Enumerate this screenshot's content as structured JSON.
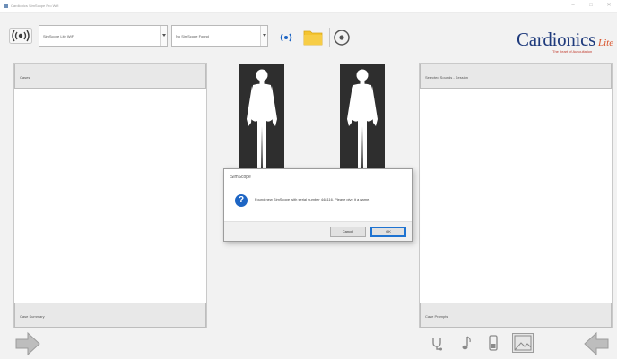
{
  "window": {
    "title": "Cardionics SimScope Pro Wifi",
    "controls": [
      "–",
      "□",
      "✕"
    ]
  },
  "toolbar": {
    "connect_icon": "signal-broadcast-icon",
    "device_dropdown": {
      "value": "SimScope Lite WiFi"
    },
    "simscope_dropdown": {
      "value": "No SimScope Found"
    },
    "wifi_icon": "wifi-signal-icon",
    "folder_icon": "folder-icon",
    "settings_icon": "circle-target-icon"
  },
  "logo": {
    "brand": "Cardionics",
    "accent": "Lite",
    "tagline": "The heart of Auscultation",
    "colors": {
      "brand": "#1e3a7c",
      "accent": "#d9532a"
    }
  },
  "left_panel": {
    "header": "Cases",
    "footer": "Case Summary"
  },
  "right_panel": {
    "header": "Selected Sounds - Session",
    "footer": "Case Prompts"
  },
  "dialog": {
    "title": "SimScope",
    "icon": "info-question-icon",
    "message": "Found new SimScope with serial number 448116. Please give it a name.",
    "buttons": {
      "ok": "OK",
      "cancel": "Cancel"
    }
  },
  "bottom_toolbar": {
    "left_arrow": "forward-arrow-icon",
    "right_arrow": "back-arrow-icon",
    "icons": [
      "stethoscope-icon",
      "music-note-icon",
      "phone-icon",
      "image-icon"
    ]
  },
  "colors": {
    "panel_bg": "#ffffff",
    "header_bg": "#e8e8e8",
    "window_bg": "#f2f2f2",
    "primary_button": "#1e73d1"
  }
}
